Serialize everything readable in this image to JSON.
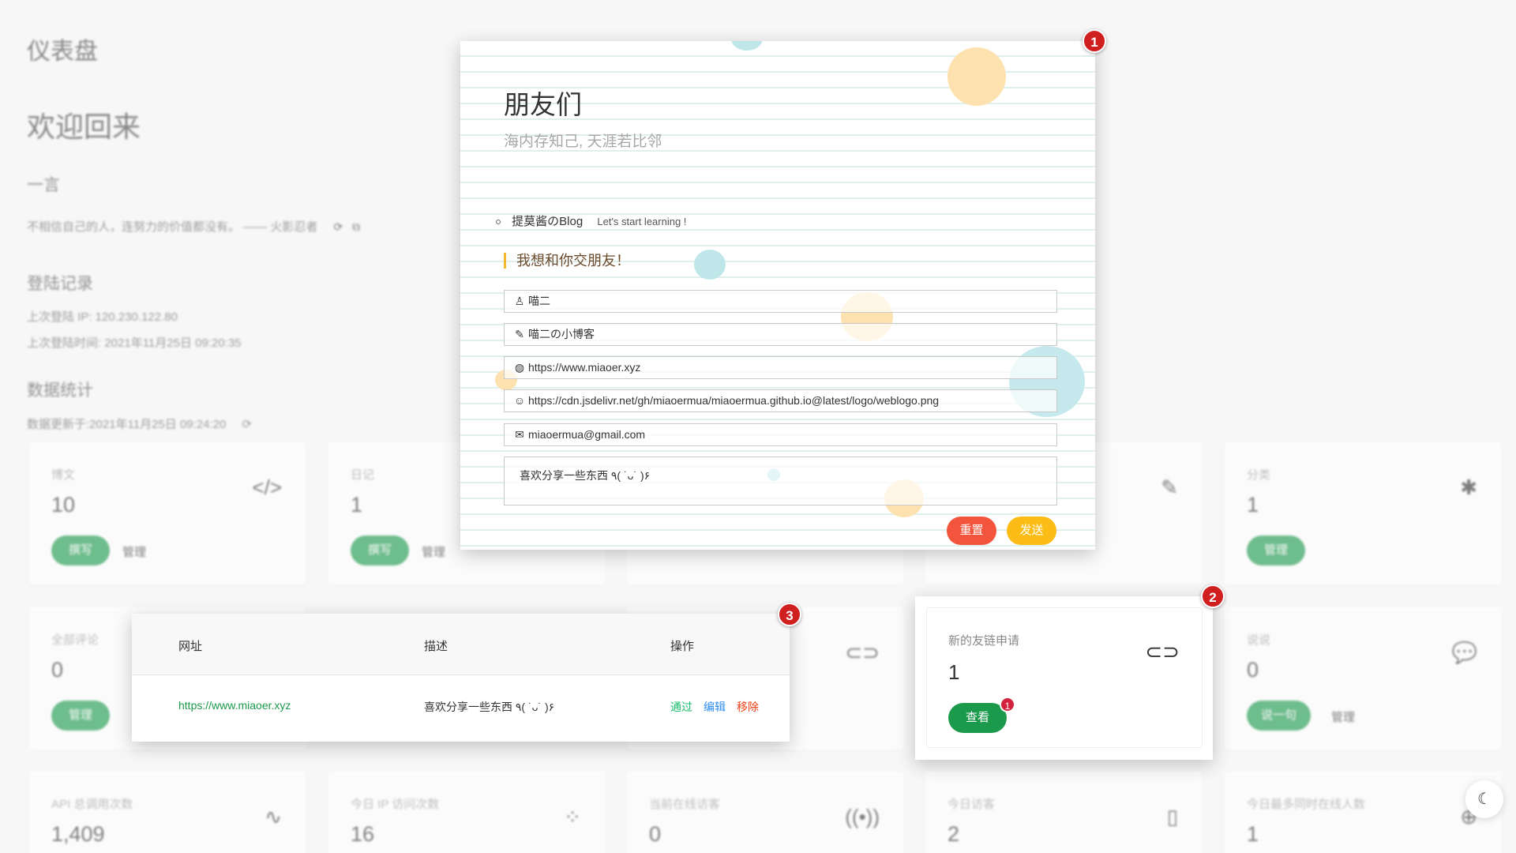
{
  "dashboard": {
    "title": "仪表盘",
    "welcome": "欢迎回来",
    "quote_heading": "一言",
    "quote": "不相信自己的人，连努力的价值都没有。 —— 火影忍者",
    "login_heading": "登陆记录",
    "last_ip": "上次登陆 IP: 120.230.122.80",
    "last_time": "上次登陆时间: 2021年11月25日 09:20:35",
    "stats_heading": "数据统计",
    "stats_updated": "数据更新于:2021年11月25日 09:24:20",
    "cards": [
      {
        "label": "博文",
        "value": "10",
        "btn": "撰写",
        "link": "管理",
        "icon": "code-icon"
      },
      {
        "label": "日记",
        "value": "1",
        "btn": "撰写",
        "link": "管理",
        "icon": "book-icon"
      },
      {
        "label": "分类",
        "value": "1",
        "btn": "管理",
        "icon": "puzzle-icon"
      },
      {
        "label": "全部评论",
        "value": "0",
        "btn": "管理",
        "icon": "comment-icon"
      },
      {
        "label": "说说",
        "value": "0",
        "btn": "说一句",
        "link": "管理",
        "icon": "chat-icon"
      },
      {
        "label": "API 总调用次数",
        "value": "1,409",
        "icon": "pulse-icon"
      },
      {
        "label": "今日 IP 访问次数",
        "value": "16",
        "icon": "cluster-icon"
      },
      {
        "label": "当前在线访客",
        "value": "0",
        "icon": "broadcast-icon"
      },
      {
        "label": "今日访客",
        "value": "2",
        "icon": "id-card-icon"
      },
      {
        "label": "今日最多同时在线人数",
        "value": "1",
        "icon": "gamepad-icon"
      }
    ]
  },
  "friends_page": {
    "badge": "1",
    "title": "朋友们",
    "subtitle": "海内存知己, 天涯若比邻",
    "friend_name": "提莫酱のBlog",
    "friend_desc": "Let's start learning !",
    "form_heading": "我想和你交朋友！",
    "name": "喵二",
    "site_name": "喵二の小博客",
    "site_url": "https://www.miaoer.xyz",
    "avatar_url": "https://cdn.jsdelivr.net/gh/miaoermua/miaoermua.github.io@latest/logo/weblogo.png",
    "email": "miaoermua@gmail.com",
    "description": "喜欢分享一些东西 ٩( ˙ᴗ˙ )۶",
    "reset_label": "重置",
    "send_label": "发送"
  },
  "friend_request": {
    "badge": "2",
    "label": "新的友链申请",
    "value": "1",
    "view_label": "查看",
    "count_badge": "1"
  },
  "review_table": {
    "badge": "3",
    "headers": [
      "网址",
      "描述",
      "操作"
    ],
    "row": {
      "url": "https://www.miaoer.xyz",
      "description": "喜欢分享一些东西 ٩( ˙ᴗ˙ )۶",
      "approve": "通过",
      "edit": "编辑",
      "remove": "移除"
    }
  },
  "colors": {
    "accent_green": "#1c9a4c",
    "badge_red": "#cf1f1f",
    "reset_red": "#f2553b",
    "send_yellow": "#fbbc15",
    "edit_blue": "#2d8cf0",
    "remove_red": "#ed4014"
  }
}
